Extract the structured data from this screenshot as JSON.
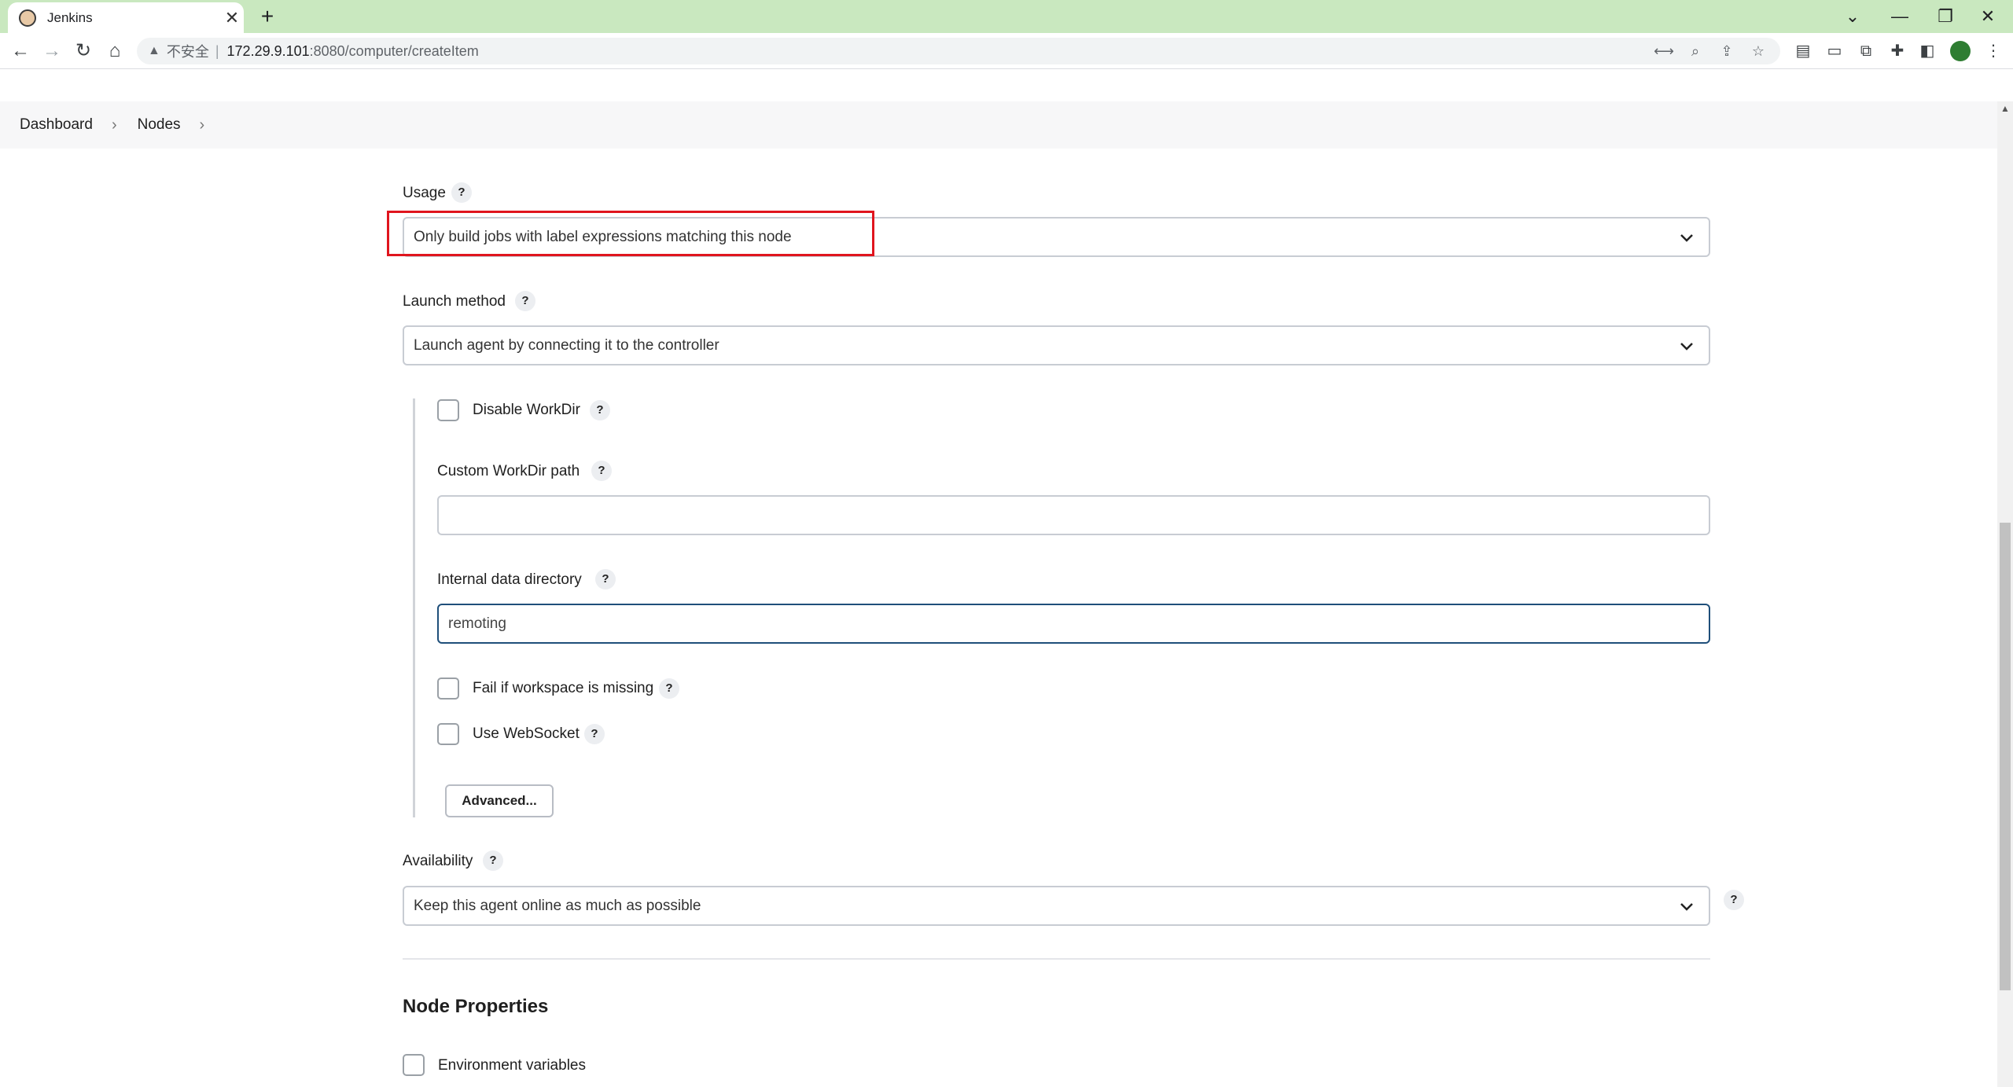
{
  "browser": {
    "tab_title": "Jenkins",
    "tab_close": "✕",
    "new_tab": "+",
    "insecure_label": "不安全",
    "url_host": "172.29.9.101",
    "url_path": ":8080/computer/createItem"
  },
  "breadcrumb": {
    "items": [
      "Dashboard",
      "Nodes"
    ],
    "separator": "›"
  },
  "form": {
    "usage": {
      "label": "Usage",
      "help": "?",
      "value": "Only build jobs with label expressions matching this node"
    },
    "launch_method": {
      "label": "Launch method",
      "help": "?",
      "value": "Launch agent by connecting it to the controller"
    },
    "disable_workdir": {
      "label": "Disable WorkDir",
      "help": "?",
      "checked": false
    },
    "custom_workdir": {
      "label": "Custom WorkDir path",
      "help": "?",
      "value": ""
    },
    "internal_data_dir": {
      "label": "Internal data directory",
      "help": "?",
      "value": "remoting"
    },
    "fail_if_missing": {
      "label": "Fail if workspace is missing",
      "help": "?",
      "checked": false
    },
    "use_websocket": {
      "label": "Use WebSocket",
      "help": "?",
      "checked": false
    },
    "advanced_button": "Advanced...",
    "availability": {
      "label": "Availability",
      "help": "?",
      "value": "Keep this agent online as much as possible",
      "side_help": "?"
    },
    "node_properties": {
      "title": "Node Properties",
      "env_vars": {
        "label": "Environment variables",
        "checked": false
      }
    }
  },
  "colors": {
    "tabstrip": "#c9e8bf",
    "highlight": "#e0151e",
    "focus_border": "#1f4f7a"
  }
}
